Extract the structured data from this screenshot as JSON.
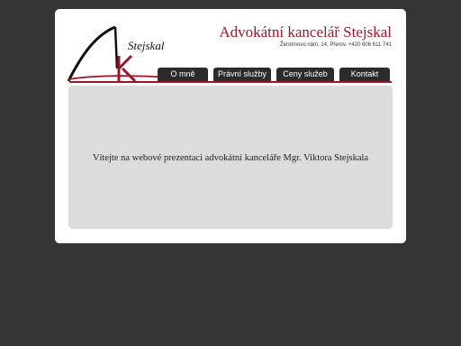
{
  "header": {
    "logo_text": "Stejskal",
    "title": "Advokátní kancelář Stejskal",
    "address": "Žerotínovo nám. 14, Přerov, +420 606 611 741"
  },
  "nav": {
    "items": [
      {
        "label": "O mně"
      },
      {
        "label": "Právní služby"
      },
      {
        "label": "Ceny služeb"
      },
      {
        "label": "Kontakt"
      }
    ]
  },
  "main": {
    "welcome_text": "Vítejte na webové prezentaci advokátní kanceláře Mgr. Viktora Stejskala"
  },
  "colors": {
    "background": "#353535",
    "accent": "#a01525",
    "nav_background": "#2b2b2b",
    "content_background": "#dcdcdc"
  }
}
